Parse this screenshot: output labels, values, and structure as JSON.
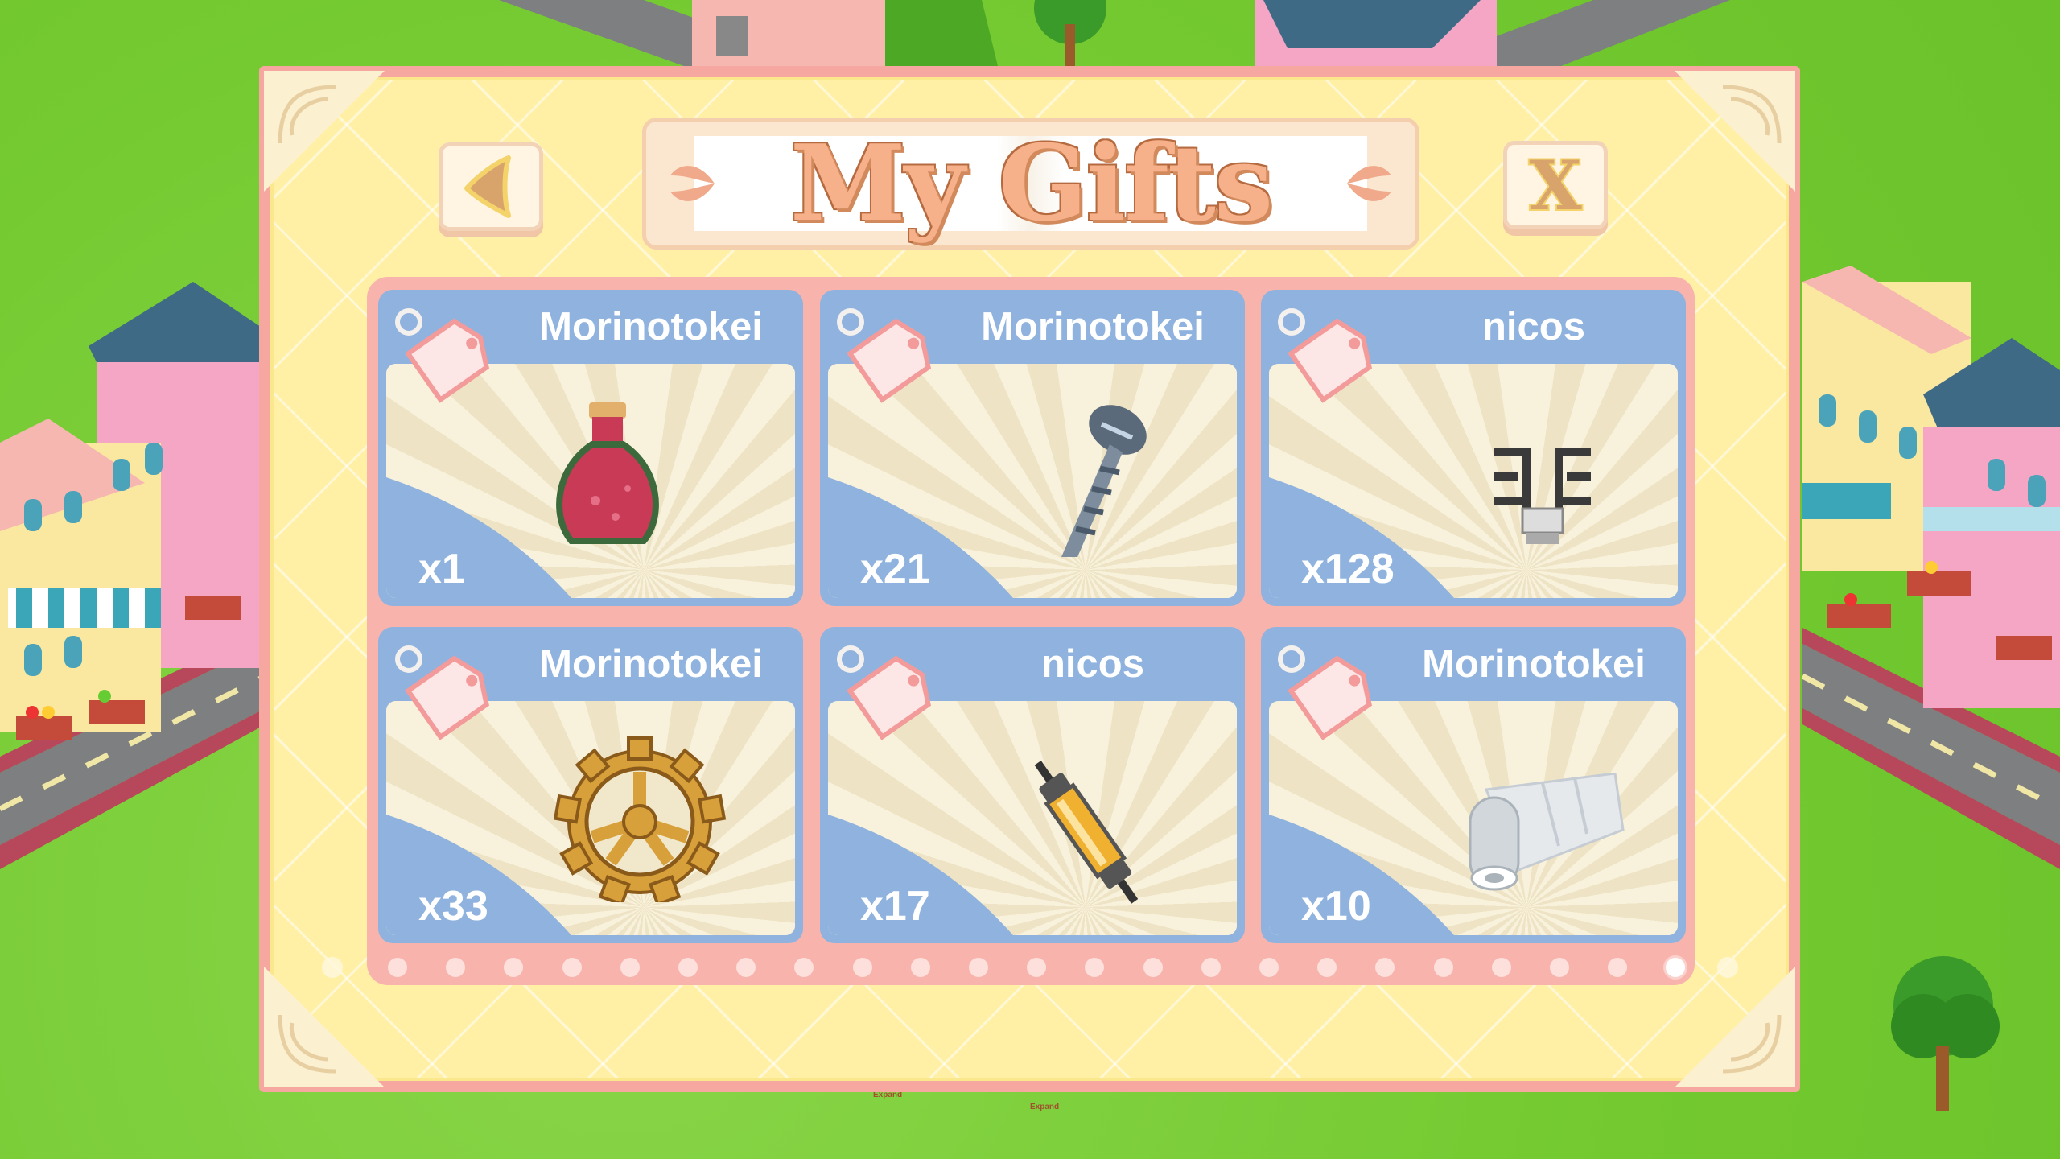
{
  "dialog": {
    "title": "My Gifts",
    "back_button_label": "◀",
    "close_button_label": "X"
  },
  "gifts": [
    {
      "sender": "Morinotokei",
      "quantity": "x1",
      "item_icon": "potion-icon"
    },
    {
      "sender": "Morinotokei",
      "quantity": "x21",
      "item_icon": "screw-icon"
    },
    {
      "sender": "nicos",
      "quantity": "x128",
      "item_icon": "pipe-fitting-icon"
    },
    {
      "sender": "Morinotokei",
      "quantity": "x33",
      "item_icon": "gear-icon"
    },
    {
      "sender": "nicos",
      "quantity": "x17",
      "item_icon": "fuse-icon"
    },
    {
      "sender": "Morinotokei",
      "quantity": "x10",
      "item_icon": "paper-roll-icon"
    }
  ],
  "pagination": {
    "total_dots": 23,
    "active_index": 22
  },
  "background": {
    "expand_signs": [
      "Expand",
      "Expand"
    ]
  },
  "colors": {
    "panel_border": "#f6a7a0",
    "panel_fill": "#fff0a6",
    "card_frame": "#8fb3de",
    "title_text": "#f7b18a",
    "grass": "#7fd23b"
  }
}
